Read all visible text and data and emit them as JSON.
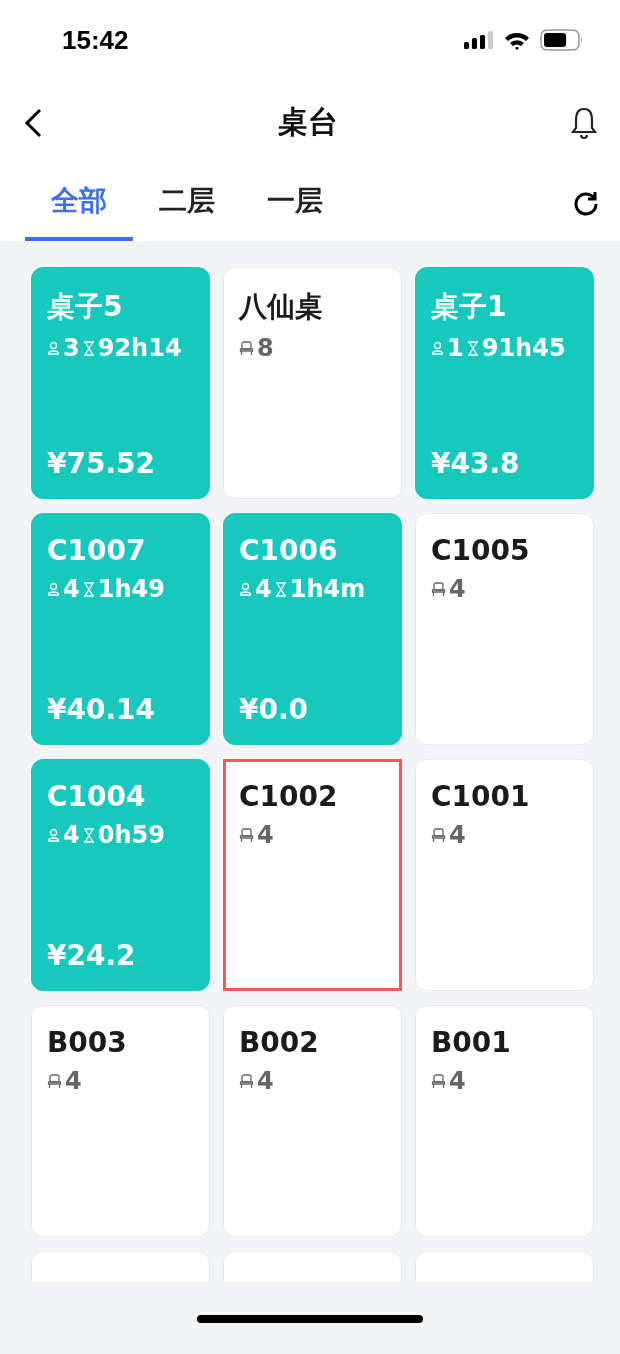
{
  "status_bar": {
    "time": "15:42"
  },
  "nav": {
    "title": "桌台"
  },
  "tabs": [
    {
      "label": "全部",
      "selected": true
    },
    {
      "label": "二层",
      "selected": false
    },
    {
      "label": "一层",
      "selected": false
    }
  ],
  "tables": [
    {
      "kind": "occupied",
      "name": "桌子5",
      "guests": "3",
      "duration": "92h14",
      "amount": "¥75.52",
      "selected": false
    },
    {
      "kind": "free",
      "name": "八仙桌",
      "seats": "8",
      "selected": false
    },
    {
      "kind": "occupied",
      "name": "桌子1",
      "guests": "1",
      "duration": "91h45",
      "amount": "¥43.8",
      "selected": false
    },
    {
      "kind": "occupied",
      "name": "C1007",
      "guests": "4",
      "duration": "1h49",
      "amount": "¥40.14",
      "selected": false
    },
    {
      "kind": "occupied",
      "name": "C1006",
      "guests": "4",
      "duration": "1h4m",
      "amount": "¥0.0",
      "selected": false
    },
    {
      "kind": "free",
      "name": "C1005",
      "seats": "4",
      "selected": false
    },
    {
      "kind": "occupied",
      "name": "C1004",
      "guests": "4",
      "duration": "0h59",
      "amount": "¥24.2",
      "selected": false
    },
    {
      "kind": "free",
      "name": "C1002",
      "seats": "4",
      "selected": true
    },
    {
      "kind": "free",
      "name": "C1001",
      "seats": "4",
      "selected": false
    },
    {
      "kind": "free",
      "name": "B003",
      "seats": "4",
      "selected": false
    },
    {
      "kind": "free",
      "name": "B002",
      "seats": "4",
      "selected": false
    },
    {
      "kind": "free",
      "name": "B001",
      "seats": "4",
      "selected": false
    },
    {
      "kind": "clipped",
      "selected": false
    },
    {
      "kind": "clipped",
      "selected": false
    },
    {
      "kind": "clipped",
      "selected": false
    }
  ]
}
